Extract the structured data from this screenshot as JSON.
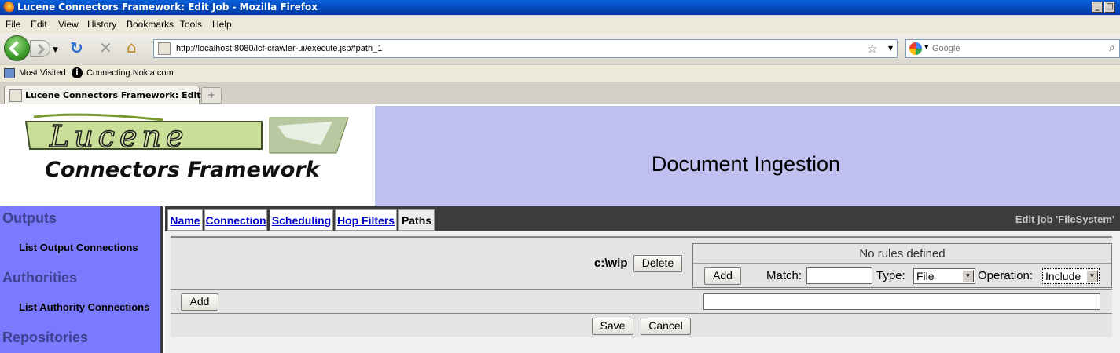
{
  "window": {
    "title": "Lucene Connectors Framework: Edit Job - Mozilla Firefox",
    "controls": [
      "_",
      "□",
      "x"
    ]
  },
  "menu": [
    "File",
    "Edit",
    "View",
    "History",
    "Bookmarks",
    "Tools",
    "Help"
  ],
  "nav": {
    "url": "http://localhost:8080/lcf-crawler-ui/execute.jsp#path_1",
    "search_placeholder": "Google"
  },
  "bookmarks": [
    "Most Visited",
    "Connecting.Nokia.com"
  ],
  "browser_tabs": {
    "active_label": "Lucene Connectors Framework: Edit ...",
    "new_tab": "+"
  },
  "header": {
    "logo_word": "Lucene",
    "logo_subtitle": "Connectors Framework",
    "title": "Document Ingestion"
  },
  "sidebar": {
    "sections": [
      {
        "heading": "Outputs",
        "link": "List Output Connections"
      },
      {
        "heading": "Authorities",
        "link": "List Authority Connections"
      },
      {
        "heading": "Repositories"
      }
    ]
  },
  "job_tabs": [
    "Name",
    "Connection",
    "Scheduling",
    "Hop Filters",
    "Paths"
  ],
  "active_tab": "Paths",
  "edit_job_label": "Edit job 'FileSystem'",
  "paths": {
    "path_value": "c:\\wip",
    "delete_label": "Delete",
    "no_rules": "No rules defined",
    "rule_add_label": "Add",
    "match_label": "Match:",
    "match_value": "",
    "type_label": "Type:",
    "type_value": "File",
    "operation_label": "Operation:",
    "operation_value": "Include",
    "add_path_label": "Add",
    "new_path_value": "",
    "save_label": "Save",
    "cancel_label": "Cancel"
  }
}
